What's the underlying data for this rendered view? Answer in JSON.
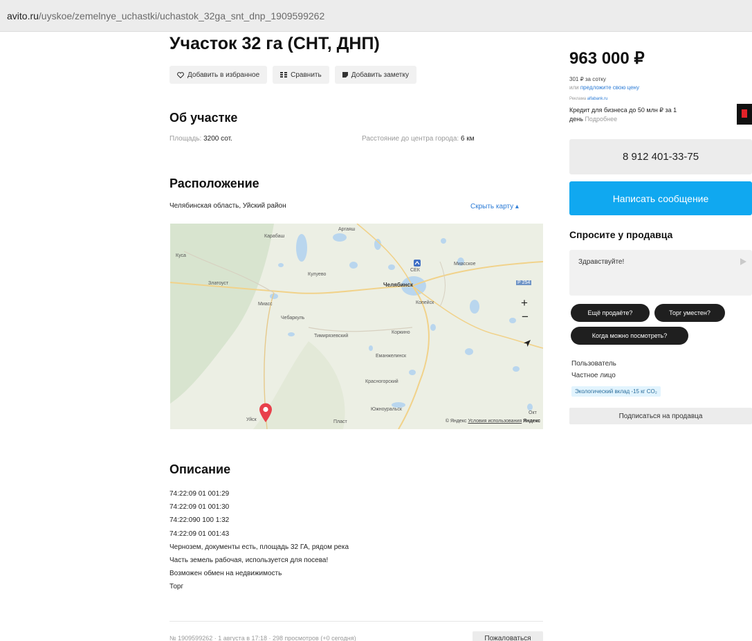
{
  "browser": {
    "url_domain": "avito.ru",
    "url_path": "/uyskoe/zemelnye_uchastki/uchastok_32ga_snt_dnp_1909599262"
  },
  "listing": {
    "title": "Участок 32 га (СНТ, ДНП)",
    "actions": {
      "favorite": "Добавить в избранное",
      "compare": "Сравнить",
      "note": "Добавить заметку"
    }
  },
  "about": {
    "heading": "Об участке",
    "area_label": "Площадь:",
    "area_value": "3200 сот.",
    "distance_label": "Расстояние до центра города:",
    "distance_value": "6 км"
  },
  "location": {
    "heading": "Расположение",
    "address": "Челябинская область, Уйский район",
    "hide_map": "Скрыть карту",
    "map": {
      "labels": {
        "karabash": "Карабаш",
        "argayash": "Аргаяш",
        "kusa": "Куса",
        "zlatoust": "Златоуст",
        "kyshtym": "Кулуево",
        "chelyabinsk": "Челябинск",
        "miass": "Миасс",
        "chebarkul": "Чебаркуль",
        "kopeysk": "Копейск",
        "timiryazevsky": "Тимирязевский",
        "korkino": "Коркино",
        "emanzhelinsk": "Еманжелинск",
        "krasnogorsky": "Красногорский",
        "yuzhnouralsk": "Южноуральск",
        "uyskoye": "Уйск",
        "plast": "Пласт",
        "miasskoye": "Миасское",
        "sek": "СЕК",
        "road": "Р 254",
        "oktyabrskoye": "Окт"
      },
      "zoom_in": "+",
      "zoom_out": "−",
      "copyright": "© Яндекс",
      "terms": "Условия использования",
      "brand": "Яндекс"
    }
  },
  "description": {
    "heading": "Описание",
    "lines": [
      "74:22:09 01 001:29",
      "74:22:09 01 001:30",
      "74:22:090 100 1:32",
      "74:22:09 01 001:43",
      "Чернозем, документы есть, площадь 32 ГА, рядом река",
      "Часть земель рабочая, используется для посева!",
      "Возможен обмен на недвижимость",
      "Торг"
    ]
  },
  "footer": {
    "info": "№ 1909599262 · 1 августа в 17:18 · 298 просмотров (+0 сегодня)",
    "complain": "Пожаловаться"
  },
  "sidebar": {
    "price": "963 000 ₽",
    "per_sotka": "301 ₽ за сотку",
    "offer_prefix": "или",
    "offer_link": "предложите свою цену",
    "ad_label": "Реклама",
    "ad_source": "alfabank.ru",
    "ad_text_line1": "Кредит для бизнеса до 50 млн ₽ за 1",
    "ad_text_line2": "день",
    "ad_more": "Подробнее",
    "phone": "8 912 401-33-75",
    "message_button": "Написать сообщение",
    "ask_heading": "Спросите у продавца",
    "ask_placeholder": "Здравствуйте!",
    "chips": {
      "still_selling": "Ещё продаёте?",
      "bargain": "Торг уместен?",
      "when_view": "Когда можно посмотреть?"
    },
    "seller_name": "Пользователь",
    "seller_type": "Частное лицо",
    "eco": "Экологический вклад -15 кг CO₂",
    "subscribe": "Подписаться на продавца"
  },
  "colors": {
    "accent": "#10a8f0",
    "link": "#2b7bd6",
    "pin": "#e8404b"
  }
}
